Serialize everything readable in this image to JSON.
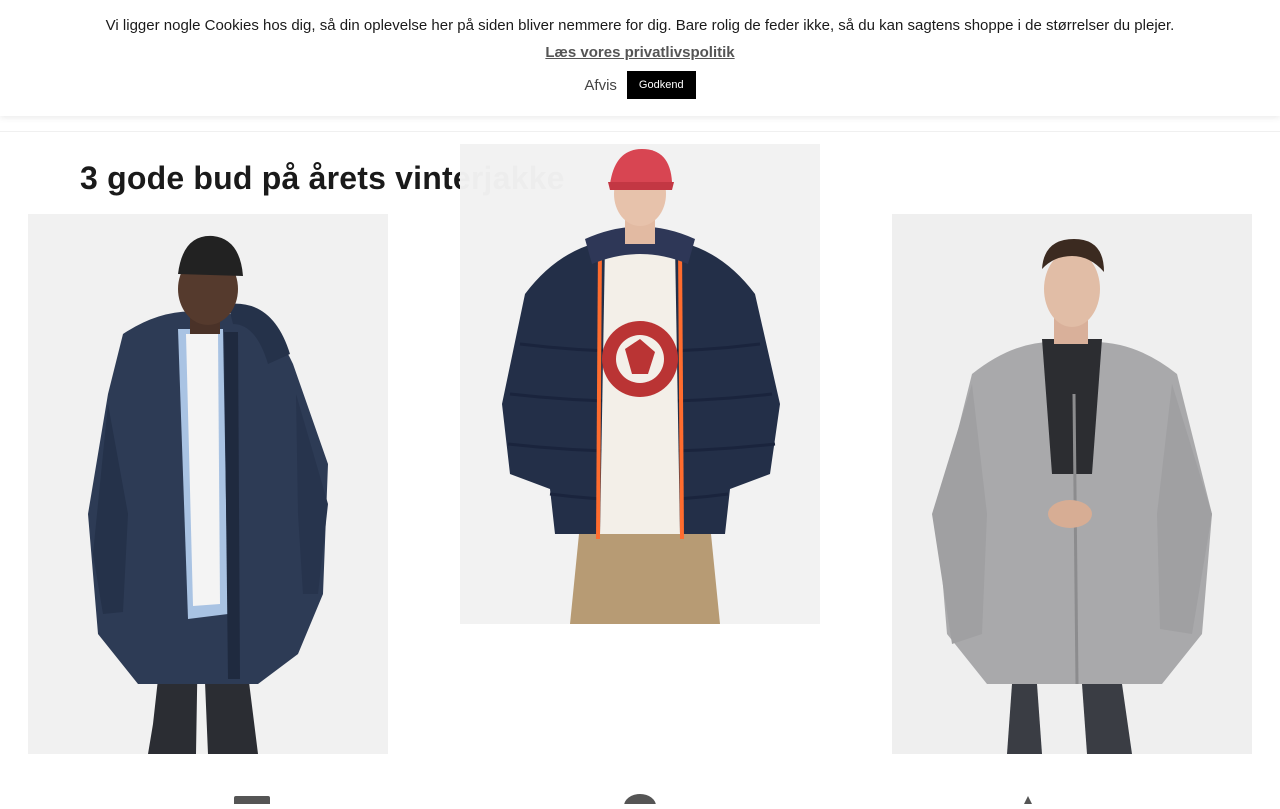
{
  "cookie_banner": {
    "message": "Vi ligger nogle Cookies hos dig, så din oplevelse her på siden bliver nemmere for dig. Bare rolig de feder ikke, så du kan sagtens shoppe i de størrelser du plejer.",
    "privacy_link": "Læs vores privatlivspolitik",
    "decline_label": "Afvis",
    "accept_label": "Godkend"
  },
  "section": {
    "title": "3 gode bud på årets vinterjakke"
  },
  "products": [
    {
      "description": "man-in-navy-parka-image"
    },
    {
      "description": "man-in-navy-puffer-jacket-image"
    },
    {
      "description": "man-in-grey-wool-coat-image"
    }
  ],
  "colors": {
    "accent_button": "#000000",
    "text": "#1a1a1a",
    "link": "#555555"
  }
}
